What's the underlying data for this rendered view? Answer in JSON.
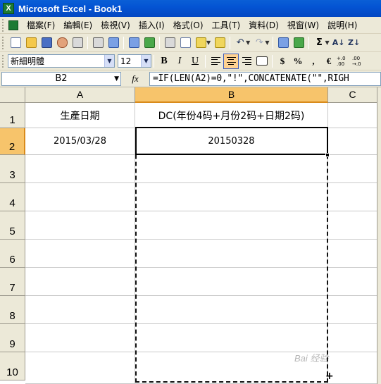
{
  "window": {
    "title": "Microsoft Excel - Book1",
    "app_icon": "X"
  },
  "menu": [
    "檔案(F)",
    "編輯(E)",
    "檢視(V)",
    "插入(I)",
    "格式(O)",
    "工具(T)",
    "資料(D)",
    "視窗(W)",
    "說明(H)"
  ],
  "toolbar2": {
    "font_name": "新細明體",
    "font_size": "12",
    "bold": "B",
    "italic": "I",
    "underline": "U",
    "currency": "$",
    "percent": "%",
    "comma": ",",
    "euro": "€",
    "inc_decimal": "+.0 .00",
    "dec_decimal": ".00 →.0"
  },
  "toolbar1": {
    "autosum": "Σ"
  },
  "formula_bar": {
    "name_box": "B2",
    "fx_label": "fx",
    "formula": "=IF(LEN(A2)=0,\"!\",CONCATENATE(\"\",RIGH"
  },
  "grid": {
    "columns": [
      "A",
      "B",
      "C"
    ],
    "selected_column": "B",
    "rows": [
      "1",
      "2",
      "3",
      "4",
      "5",
      "6",
      "7",
      "8",
      "9",
      "10"
    ],
    "selected_row": "2",
    "cells": {
      "A1": "生產日期",
      "B1": "DC(年份4码+月份2码+日期2码)",
      "A2": "2015/03/28",
      "B2": "20150328"
    }
  },
  "watermark": "Bai 经验"
}
